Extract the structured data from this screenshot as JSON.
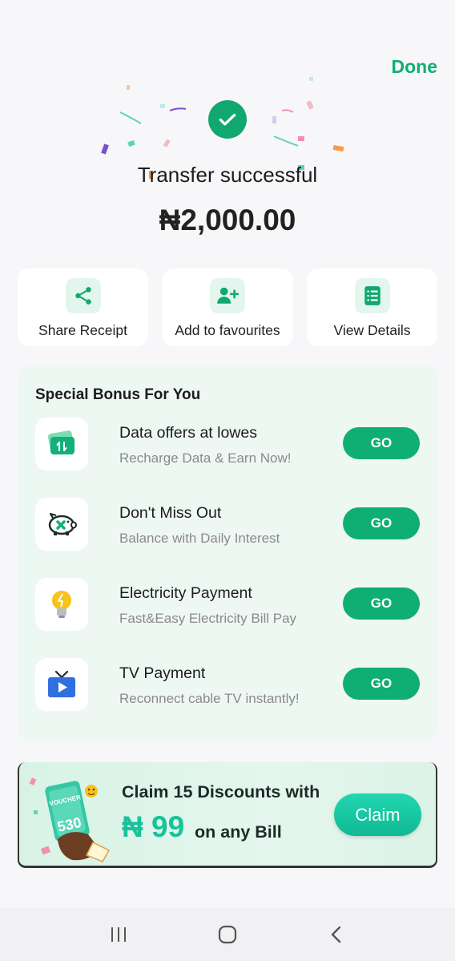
{
  "header": {
    "done_label": "Done"
  },
  "result": {
    "title": "Transfer successful",
    "amount": "₦2,000.00"
  },
  "actions": [
    {
      "label": "Share Receipt",
      "icon": "share-icon"
    },
    {
      "label": "Add to favourites",
      "icon": "add-user-icon"
    },
    {
      "label": "View Details",
      "icon": "document-list-icon"
    }
  ],
  "bonus": {
    "title": "Special Bonus For You",
    "items": [
      {
        "name": "Data offers at lowes",
        "desc": "Recharge Data & Earn Now!",
        "button": "GO",
        "icon": "data-card-icon"
      },
      {
        "name": "Don't Miss Out",
        "desc": "Balance with Daily Interest",
        "button": "GO",
        "icon": "piggy-bank-icon"
      },
      {
        "name": "Electricity Payment",
        "desc": "Fast&Easy Electricity Bill Pay",
        "button": "GO",
        "icon": "light-bulb-icon"
      },
      {
        "name": "TV Payment",
        "desc": "Reconnect cable TV instantly!",
        "button": "GO",
        "icon": "tv-icon"
      }
    ]
  },
  "banner": {
    "line1": "Claim 15 Discounts with",
    "price": "₦ 99",
    "line2": "on any Bill",
    "claim_label": "Claim",
    "voucher_label": "VOUCHER",
    "voucher_value": "530"
  },
  "colors": {
    "accent": "#0fae72",
    "banner_price": "#19c39a",
    "claim": "#14c59e"
  }
}
